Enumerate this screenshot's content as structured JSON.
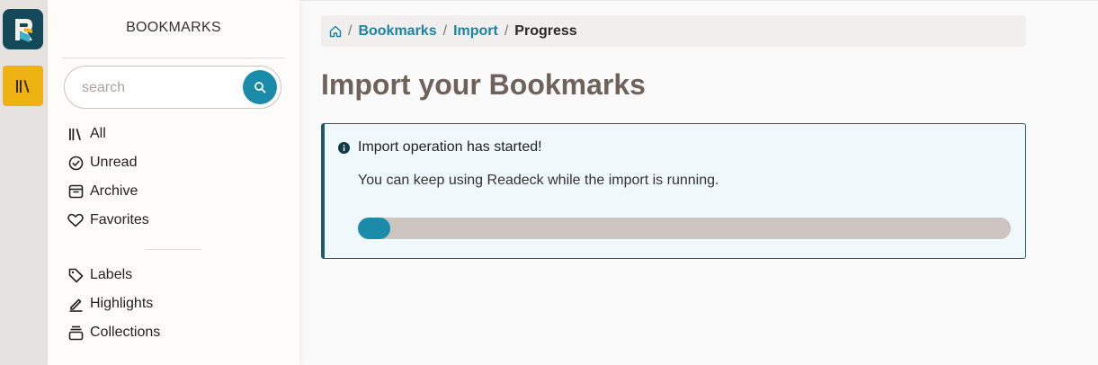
{
  "sidebar": {
    "title": "BOOKMARKS",
    "search": {
      "placeholder": "search",
      "value": ""
    },
    "items": [
      {
        "label": "All",
        "icon": "library-icon"
      },
      {
        "label": "Unread",
        "icon": "check-circle-icon"
      },
      {
        "label": "Archive",
        "icon": "archive-box-icon"
      },
      {
        "label": "Favorites",
        "icon": "heart-icon"
      },
      {
        "label": "Labels",
        "icon": "tag-icon"
      },
      {
        "label": "Highlights",
        "icon": "pen-icon"
      },
      {
        "label": "Collections",
        "icon": "stack-icon"
      }
    ]
  },
  "breadcrumb": {
    "home_icon": "home-icon",
    "items": [
      "Bookmarks",
      "Import"
    ],
    "current": "Progress"
  },
  "main": {
    "title": "Import your Bookmarks",
    "alert": {
      "heading": "Import operation has started!",
      "message": "You can keep using Readeck while the import is running.",
      "progress_fraction": 0.05
    }
  },
  "colors": {
    "accent": "#1a8ba8",
    "rail_active": "#eeb212",
    "logo_bg": "#14495a",
    "title": "#6f625a"
  }
}
